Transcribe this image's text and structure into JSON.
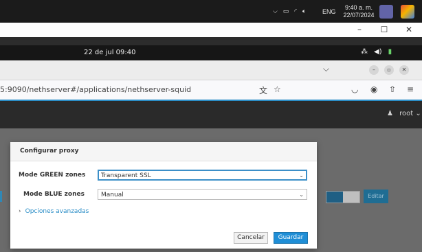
{
  "windows": {
    "clock_time": "9:40 a. m.",
    "clock_date": "22/07/2024",
    "language": "ENG",
    "tray_icons": [
      "chevron-up-icon",
      "battery-icon",
      "wifi-icon",
      "volume-icon"
    ],
    "apps": [
      {
        "name": "chat-app-icon",
        "color": "#6264a7"
      },
      {
        "name": "color-app-icon",
        "color": "#e0822f"
      }
    ],
    "window_controls": [
      "–",
      "☐",
      "✕"
    ]
  },
  "gnome": {
    "clock": "22 de jul  09:40",
    "icons": [
      "network-icon",
      "volume-icon",
      "battery-icon"
    ]
  },
  "browser": {
    "url": "5:9090/nethserver#/applications/nethserver-squid",
    "window_buttons": [
      "–",
      "▫",
      "✕"
    ]
  },
  "cockpit": {
    "user": "root"
  },
  "background": {
    "edit_label": "Editar"
  },
  "modal": {
    "title": "Configurar proxy",
    "fields": [
      {
        "label": "Mode GREEN zones",
        "value": "Transparent SSL"
      },
      {
        "label": "Mode BLUE zones",
        "value": "Manual"
      }
    ],
    "advanced_link": "Opciones avanzadas",
    "cancel_label": "Cancelar",
    "save_label": "Guardar"
  },
  "colors": {
    "accent": "#1f8ed6",
    "link": "#2b8ec7"
  }
}
